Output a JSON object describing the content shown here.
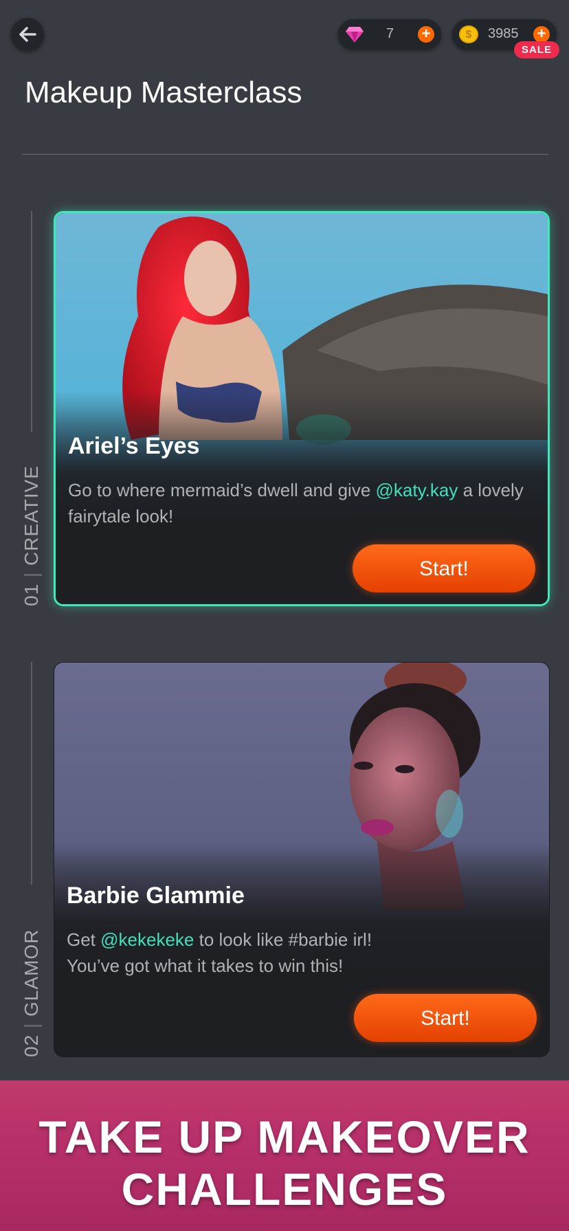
{
  "header": {
    "back_icon": "arrow-left-icon",
    "gems": {
      "icon": "gem-icon",
      "value": "7",
      "plus": "+"
    },
    "coins": {
      "icon": "coin-icon",
      "symbol": "$",
      "value": "3985",
      "plus": "+"
    },
    "sale_badge": "SALE"
  },
  "page_title": "Makeup Masterclass",
  "challenges": [
    {
      "number": "01",
      "category": "CREATIVE",
      "title": "Ariel’s Eyes",
      "desc_pre": "Go to where mermaid’s dwell and give ",
      "mention": "@katy.kay",
      "desc_post": " a lovely fairytale look!",
      "button": "Start!",
      "selected": true
    },
    {
      "number": "02",
      "category": "GLAMOR",
      "title": "Barbie Glammie",
      "desc_pre": "Get ",
      "mention": "@kekekeke",
      "desc_post": " to look like #barbie irl! You’ve got what it takes to win this!",
      "button": "Start!",
      "selected": false
    }
  ],
  "banner": {
    "line1": "TAKE UP MAKEOVER",
    "line2": "CHALLENGES"
  },
  "colors": {
    "accent": "#3ee8b8",
    "button": "#e44100",
    "background": "#383b41",
    "banner": "#b8306a"
  }
}
